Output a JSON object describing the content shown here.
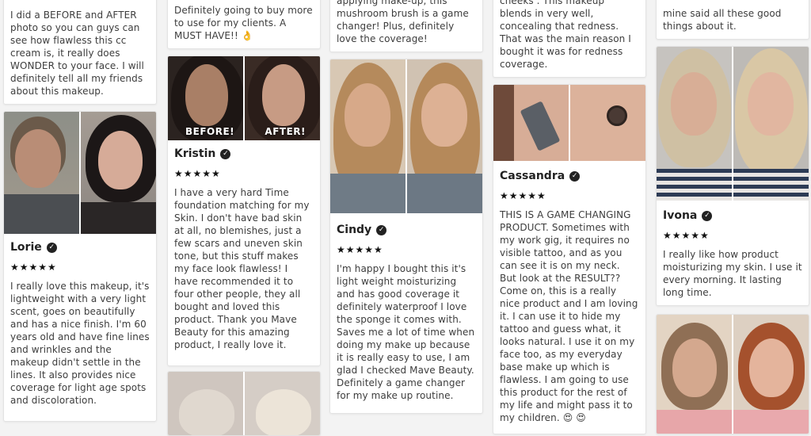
{
  "col1": {
    "top_card_text": "I did a BEFORE and AFTER photo so you can guys can see how flawless this cc cream is, it really does WONDER to your face. I will definitely tell all my friends about this makeup.",
    "review": {
      "name": "Lorie",
      "stars": "★★★★★",
      "text": "I really love this makeup, it's lightweight with a very light scent, goes on beautifully and has a nice finish. I'm 60 years old and have fine lines and wrinkles and the makeup didn't settle in the lines. It also provides nice coverage for light age spots and discoloration."
    }
  },
  "col2": {
    "top_card_text": "Definitely going to buy more to use for my clients. A MUST HAVE!!",
    "top_card_emoji": "👌",
    "review": {
      "before_label": "BEFORE!",
      "after_label": "AFTER!",
      "name": "Kristin",
      "stars": "★★★★★",
      "text": "I have a very hard Time foundation matching for my Skin. I don't have bad skin at all, no blemishes, just a few scars and uneven skin tone, but this stuff makes my face look flawless! I have recommended it to four other people, they all bought and loved this product. Thank you Mave Beauty for this amazing product, I really love it."
    }
  },
  "col3": {
    "top_card_text": "applying make-up, this mushroom brush is a game changer! Plus, definitely love the coverage!",
    "review": {
      "name": "Cindy",
      "stars": "★★★★★",
      "text": "I'm happy I bought this it's light weight moisturizing and has good coverage it definitely waterproof I love the sponge it comes with. Saves me a lot of time when doing my make up because it is really easy to use, I am glad I checked Mave Beauty. Definitely a game changer for my make up routine."
    }
  },
  "col4": {
    "top_card_text": "cheeks . This makeup blends in very well, concealing that redness. That was the main reason I bought it was for redness coverage.",
    "review": {
      "name": "Cassandra",
      "stars": "★★★★★",
      "text": "THIS IS A GAME CHANGING PRODUCT. Sometimes with my work gig, it requires no visible tattoo, and as you can see it is on my neck. But look at the RESULT?? Come on, this is a really nice product and I am loving it. I can use it to hide my tattoo and guess what, it looks natural. I use it on my face too, as my everyday base make up which is flawless. I am going to use this product for the rest of my life and might pass it to my children.",
      "emoji": "😍 😍"
    }
  },
  "col5": {
    "top_card_text": "mine said all these good things about it.",
    "review": {
      "name": "Ivona",
      "stars": "★★★★★",
      "text": "I really like how product moisturizing my skin. I use it every morning. It lasting long time."
    }
  },
  "colors": {
    "page_bg": "#f3f3f3",
    "card_bg": "#ffffff",
    "text": "#3d3d3d",
    "star": "#111111"
  }
}
